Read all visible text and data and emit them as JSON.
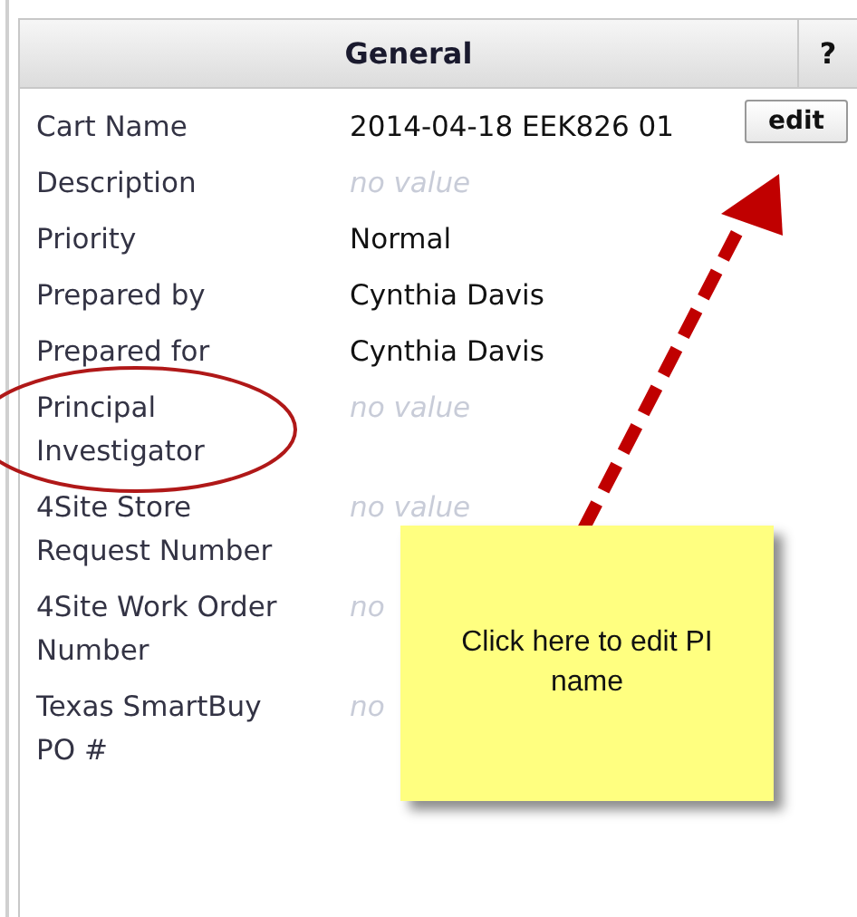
{
  "panel": {
    "title": "General",
    "help": "?"
  },
  "fields": [
    {
      "label": "Cart Name",
      "value": "2014-04-18 EEK826 01",
      "empty": false,
      "action": "edit"
    },
    {
      "label": "Description",
      "value": "no value",
      "empty": true
    },
    {
      "label": "Priority",
      "value": "Normal",
      "empty": false
    },
    {
      "label": "Prepared by",
      "value": "Cynthia Davis",
      "empty": false
    },
    {
      "label": "Prepared for",
      "value": "Cynthia Davis",
      "empty": false
    },
    {
      "label": "Principal Investigator",
      "value": "no value",
      "empty": true
    },
    {
      "label": "4Site Store Request Number",
      "value": "no value",
      "empty": true
    },
    {
      "label": "4Site Work Order Number",
      "value": "no",
      "empty": true
    },
    {
      "label": "Texas SmartBuy PO #",
      "value": "no",
      "empty": true
    }
  ],
  "annotation": {
    "note": "Click here to edit PI name"
  }
}
